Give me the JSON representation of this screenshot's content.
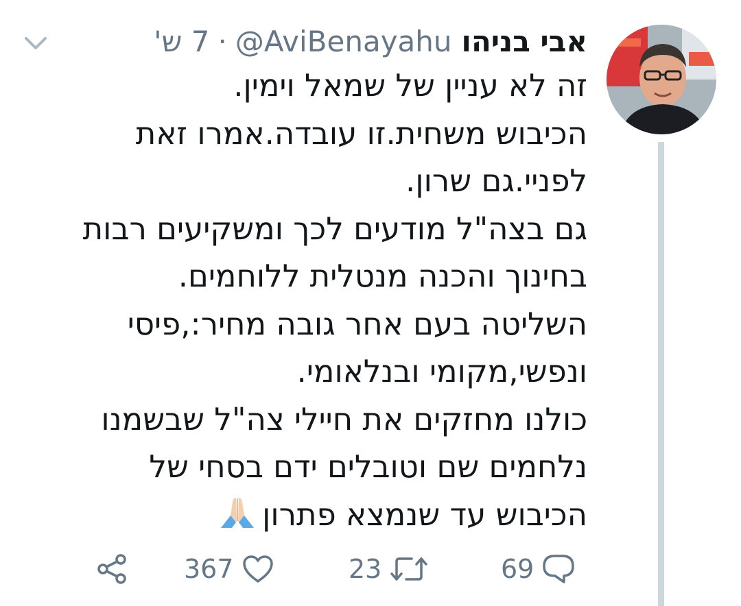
{
  "tweet": {
    "display_name": "אבי בניהו",
    "handle": "@AviBenayahu",
    "separator": "·",
    "time": "7 ש'",
    "lines": [
      "זה לא עניין של שמאל וימין.",
      "הכיבוש משחית.זו עובדה.אמרו זאת",
      "לפניי.גם שרון.",
      "גם בצה\"ל מודעים לכך ומשקיעים רבות",
      "בחינוך והכנה מנטלית ללוחמים.",
      "השליטה בעם אחר גובה מחיר:,פיסי",
      "ונפשי,מקומי ובנלאומי.",
      "כולנו מחזקים את חיילי צה\"ל שבשמנו",
      "נלחמים שם וטובלים ידם בסחי של",
      "הכיבוש עד שנמצא פתרון"
    ],
    "emoji": "folded-hands-emoji"
  },
  "actions": {
    "reply_count": "69",
    "retweet_count": "23",
    "like_count": "367",
    "icons": [
      "reply-icon",
      "retweet-icon",
      "like-icon",
      "share-icon"
    ]
  },
  "colors": {
    "text": "#14171a",
    "secondary": "#657786",
    "thread_line": "#ccd6dd"
  }
}
